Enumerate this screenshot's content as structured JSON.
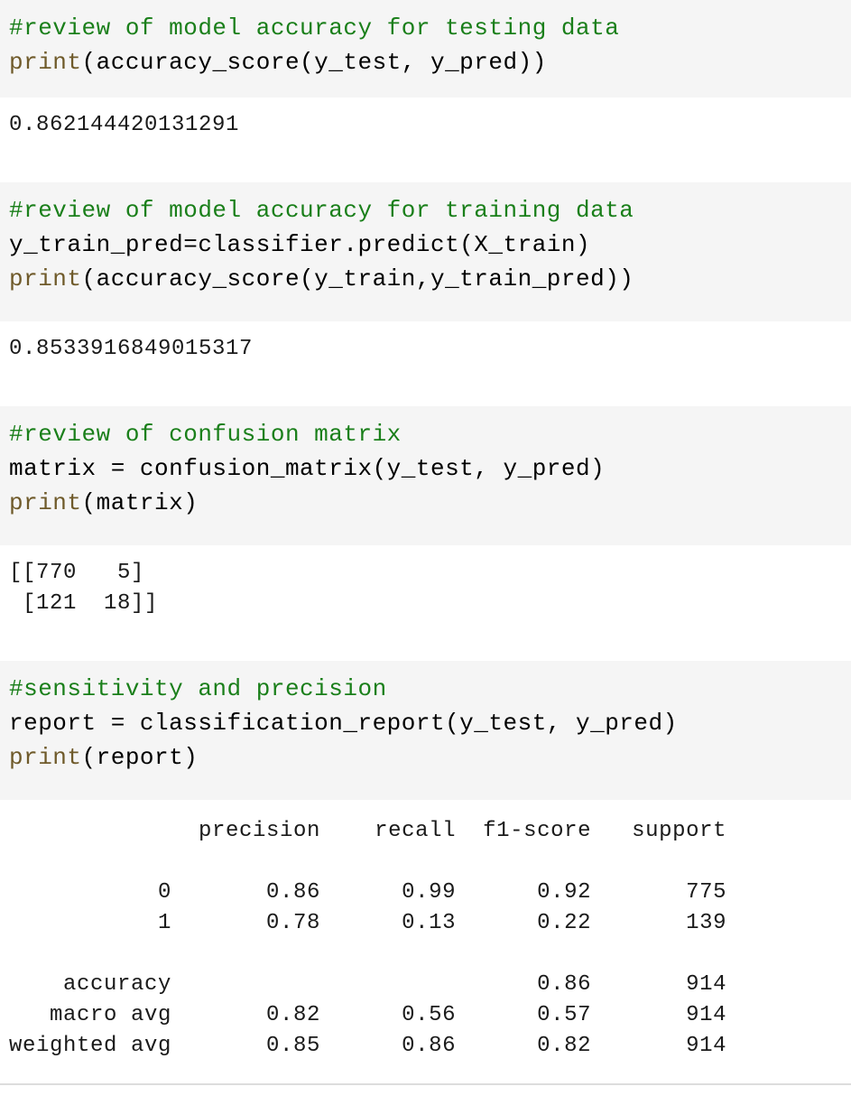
{
  "cells": [
    {
      "comment": "#review of model accuracy for testing data",
      "lines": [
        {
          "kw": "print",
          "rest": "(accuracy_score(y_test, y_pred))"
        }
      ],
      "output": "0.862144420131291"
    },
    {
      "comment": "#review of model accuracy for training data",
      "lines": [
        {
          "kw": "",
          "rest": "y_train_pred=classifier.predict(X_train)"
        },
        {
          "kw": "print",
          "rest": "(accuracy_score(y_train,y_train_pred))"
        }
      ],
      "output": "0.8533916849015317"
    },
    {
      "comment": "#review of confusion matrix",
      "lines": [
        {
          "kw": "",
          "rest": "matrix = confusion_matrix(y_test, y_pred)"
        },
        {
          "kw": "print",
          "rest": "(matrix)"
        }
      ],
      "output": "[[770   5]\n [121  18]]"
    },
    {
      "comment": "#sensitivity and precision",
      "lines": [
        {
          "kw": "",
          "rest": "report = classification_report(y_test, y_pred)"
        },
        {
          "kw": "print",
          "rest": "(report)"
        }
      ],
      "output": "              precision    recall  f1-score   support\n\n           0       0.86      0.99      0.92       775\n           1       0.78      0.13      0.22       139\n\n    accuracy                           0.86       914\n   macro avg       0.82      0.56      0.57       914\nweighted avg       0.85      0.86      0.82       914"
    }
  ]
}
